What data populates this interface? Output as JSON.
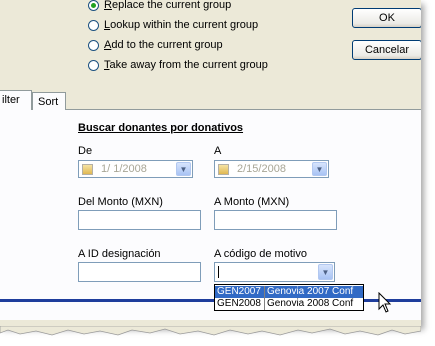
{
  "options": [
    {
      "label": "Replace the current group",
      "acc": "R",
      "checked": true
    },
    {
      "label": "Lookup within the current group",
      "acc": "L",
      "checked": false
    },
    {
      "label": "Add to the current group",
      "acc": "A",
      "checked": false
    },
    {
      "label": "Take away from the current group",
      "acc": "T",
      "checked": false
    }
  ],
  "buttons": {
    "ok": "OK",
    "cancel": "Cancelar"
  },
  "tabs": {
    "filter": "ilter",
    "sort": "Sort"
  },
  "form": {
    "heading": "Buscar donantes por donativos",
    "from_label": "De",
    "from_date": "1/  1/2008",
    "to_label": "A",
    "to_date": "2/15/2008",
    "amount_from_label": "Del Monto (MXN)",
    "amount_to_label": "A Monto (MXN)",
    "designation_label": "A ID designación",
    "motive_label": "A código de motivo"
  },
  "dropdown": [
    {
      "code": "GEN2007",
      "name": "Genovia 2007 Conf",
      "selected": true
    },
    {
      "code": "GEN2008",
      "name": "Genovia 2008 Conf",
      "selected": false
    }
  ],
  "colors": {
    "selection": "#316ac5",
    "radio_dot": "#21a121",
    "panel_line": "#1e3d9c"
  }
}
